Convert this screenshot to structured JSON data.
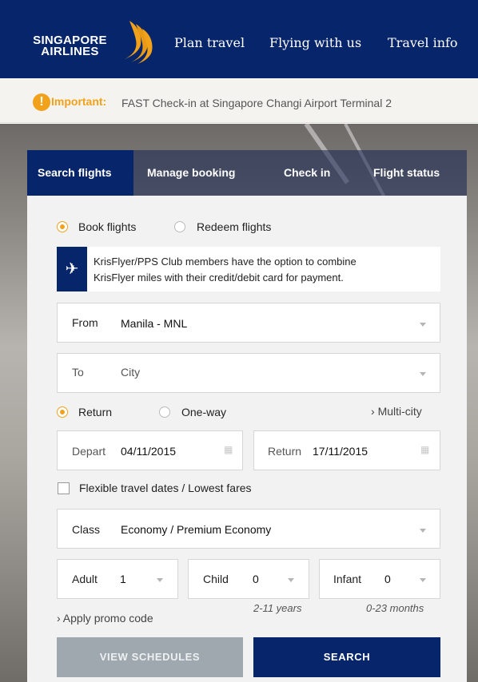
{
  "brand": {
    "line1": "SINGAPORE",
    "line2": "AIRLINES",
    "colors": {
      "navy": "#07256a",
      "gold": "#f2a21a"
    }
  },
  "nav": {
    "items": [
      "Plan travel",
      "Flying with us",
      "Travel info"
    ]
  },
  "alert": {
    "icon": "!",
    "label": "Important:",
    "text": "FAST Check-in at Singapore Changi Airport Terminal 2"
  },
  "tabs": [
    {
      "label": "Search flights",
      "active": true
    },
    {
      "label": "Manage booking",
      "active": false
    },
    {
      "label": "Check in",
      "active": false
    },
    {
      "label": "Flight status",
      "active": false
    }
  ],
  "booking_type": {
    "options": [
      "Book flights",
      "Redeem flights"
    ],
    "selected": "Book flights"
  },
  "info": {
    "icon": "airplane-icon",
    "text_line1": "KrisFlyer/PPS Club members have the option to combine",
    "text_line2": "KrisFlyer miles with their credit/debit card for payment."
  },
  "from": {
    "label": "From",
    "value": "Manila - MNL"
  },
  "to": {
    "label": "To",
    "placeholder": "City"
  },
  "trip_type": {
    "options": [
      "Return",
      "One-way"
    ],
    "selected": "Return",
    "multi_city": "Multi-city"
  },
  "depart": {
    "label": "Depart",
    "value": "04/11/2015"
  },
  "return_date": {
    "label": "Return",
    "value": "17/11/2015"
  },
  "flexible": {
    "label": "Flexible travel dates / Lowest fares",
    "checked": false
  },
  "cabin": {
    "label": "Class",
    "value": "Economy / Premium Economy"
  },
  "passengers": {
    "adult": {
      "label": "Adult",
      "value": "1"
    },
    "child": {
      "label": "Child",
      "value": "0",
      "hint": "2-11 years"
    },
    "infant": {
      "label": "Infant",
      "value": "0",
      "hint": "0-23 months"
    }
  },
  "promo": {
    "label": "Apply promo code"
  },
  "buttons": {
    "schedules": "VIEW SCHEDULES",
    "search": "SEARCH"
  }
}
